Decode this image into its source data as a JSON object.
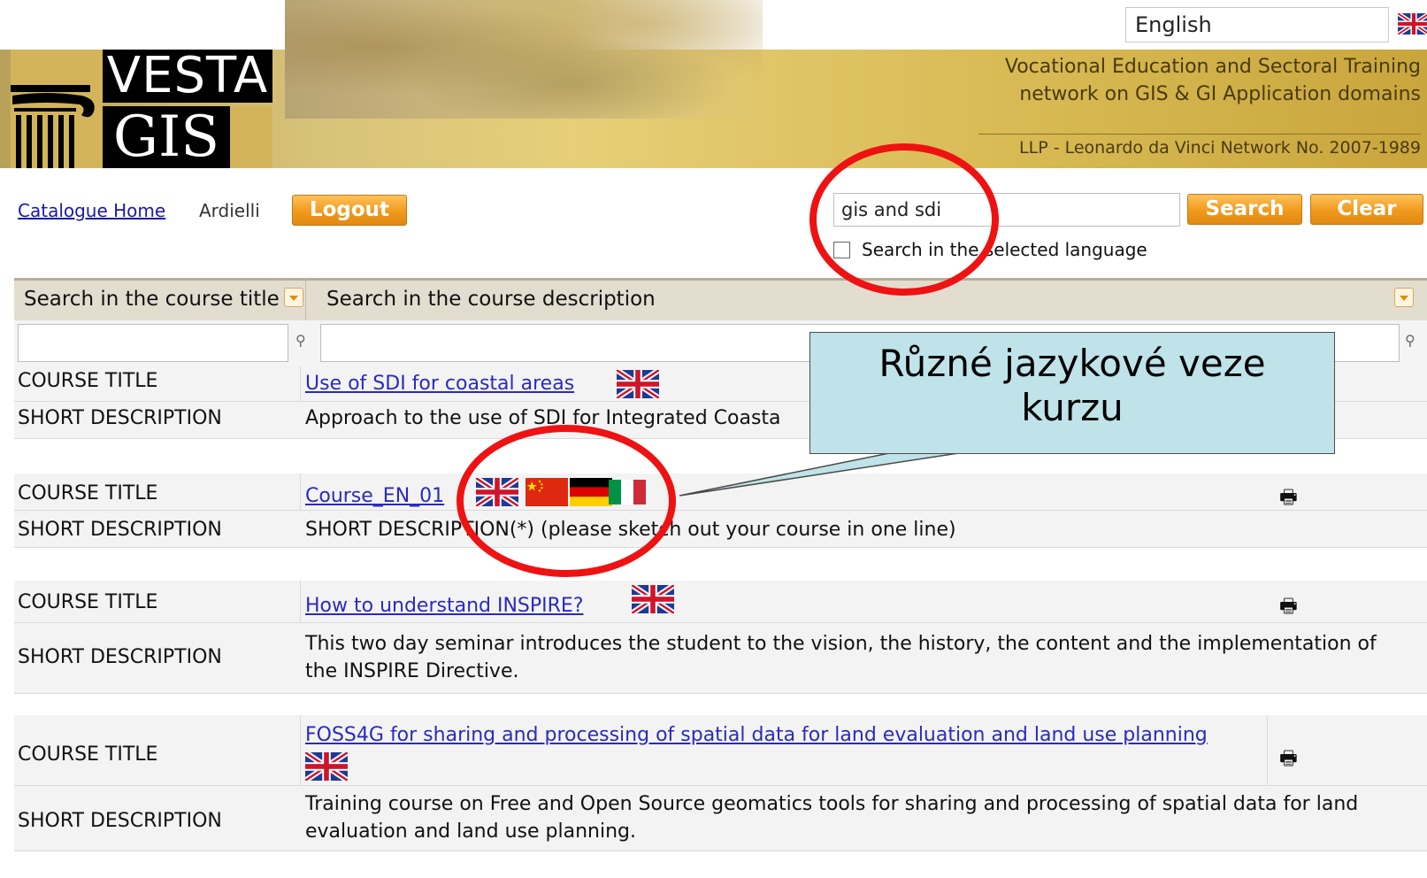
{
  "language": {
    "selected": "English",
    "flag": "uk-flag"
  },
  "banner": {
    "logo_top": "VESTA",
    "logo_bottom": "GIS",
    "tagline_1": "Vocational Education and Sectoral Training",
    "tagline_2": "network on GIS & GI Application domains",
    "program": "LLP - Leonardo da Vinci Network No. 2007-1989"
  },
  "nav": {
    "catalogue_home": "Catalogue Home",
    "user": "Ardielli",
    "logout": "Logout"
  },
  "search": {
    "value": "gis and sdi",
    "search_label": "Search",
    "clear_label": "Clear",
    "checkbox_label": "Search in the selected language",
    "checked": false
  },
  "filters": {
    "title_option": "Search in the course title",
    "desc_option": "Search in the course description"
  },
  "labels": {
    "course_title": "COURSE TITLE",
    "short_description": "SHORT DESCRIPTION"
  },
  "courses": [
    {
      "title": "Use of SDI for coastal areas",
      "flags": [
        "uk-flag"
      ],
      "description": "Approach to the use of SDI for Integrated Coasta",
      "printer": false
    },
    {
      "title": "Course_EN_01",
      "flags": [
        "uk-flag",
        "china-flag",
        "germany-flag",
        "italy-flag"
      ],
      "description": "SHORT DESCRIPTION(*) (please sketch out your course in one line)",
      "printer": true
    },
    {
      "title": "How to understand INSPIRE?",
      "flags": [
        "uk-flag"
      ],
      "description_1": "This two day seminar introduces the student to the vision, the history, the content and the implementation of",
      "description_2": "the INSPIRE Directive.",
      "printer": true
    },
    {
      "title": "FOSS4G for sharing and processing of spatial data for land evaluation and land use planning",
      "flags": [
        "uk-flag"
      ],
      "description_1": "Training course on Free and Open Source geomatics tools for sharing and processing of spatial data for land",
      "description_2": "evaluation and land use planning.",
      "printer": true
    }
  ],
  "callout": {
    "line_1": "Různé jazykové veze",
    "line_2": "kurzu"
  },
  "icons": {
    "printer": "printer-icon",
    "filter": "filter-icon",
    "dropdown": "chevron-down-icon"
  },
  "colors": {
    "accent_orange": "#f09a1d",
    "link_blue": "#2a2ac0",
    "highlight_red": "#ee1212",
    "callout_bg": "#bfe3e8"
  }
}
